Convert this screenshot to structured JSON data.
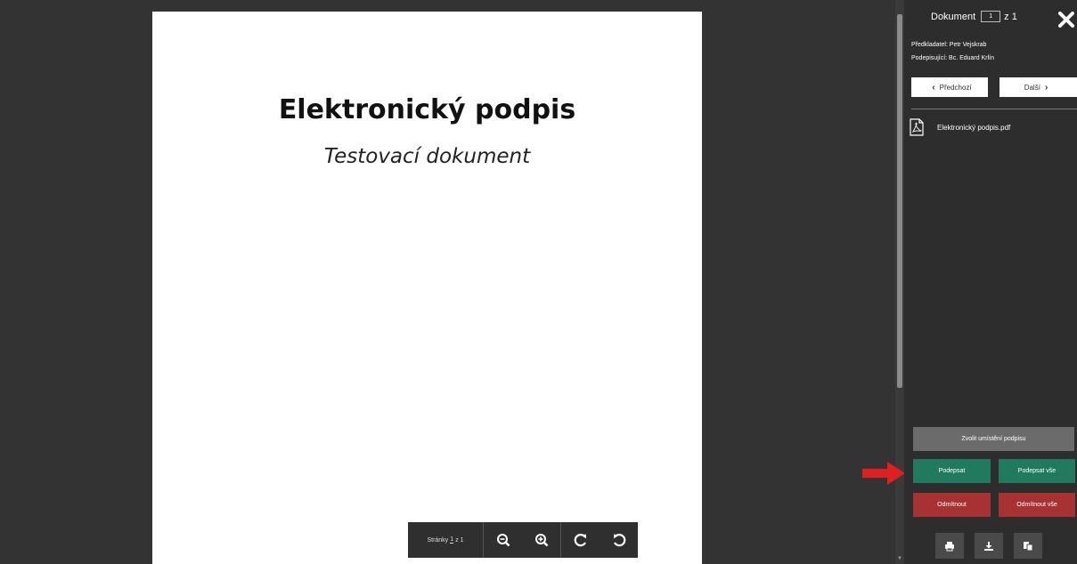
{
  "document_page": {
    "title": "Elektronický podpis",
    "subtitle": "Testovací dokument"
  },
  "toolbar": {
    "pages_label": "Stránky",
    "page_number": "1",
    "page_total": "z 1",
    "icons": [
      "zoom-out-icon",
      "zoom-in-icon",
      "rotate-clockwise-icon",
      "rotate-counterclockwise-icon"
    ]
  },
  "panel": {
    "document_label": "Dokument",
    "document_number": "1",
    "document_total": "z 1",
    "submitter": "Předkladatel: Petr Vejskrab",
    "signer": "Podepisující: Bc. Eduard Krlín",
    "prev_label": "Předchozí",
    "next_label": "Další",
    "file_name": "Elektronický podpis.pdf",
    "choose_position_label": "Zvolit umístění podpisu",
    "sign_label": "Podepsat",
    "sign_all_label": "Podepsat vše",
    "reject_label": "Odmítnout",
    "reject_all_label": "Odmítnout vše",
    "bottom_icons": [
      "print-icon",
      "download-icon",
      "copy-icon"
    ]
  },
  "colors": {
    "sign_green": "#1f7a5e",
    "reject_red": "#a83232",
    "choose_gray": "#6b6b6b",
    "annotation_arrow": "#e02020"
  }
}
